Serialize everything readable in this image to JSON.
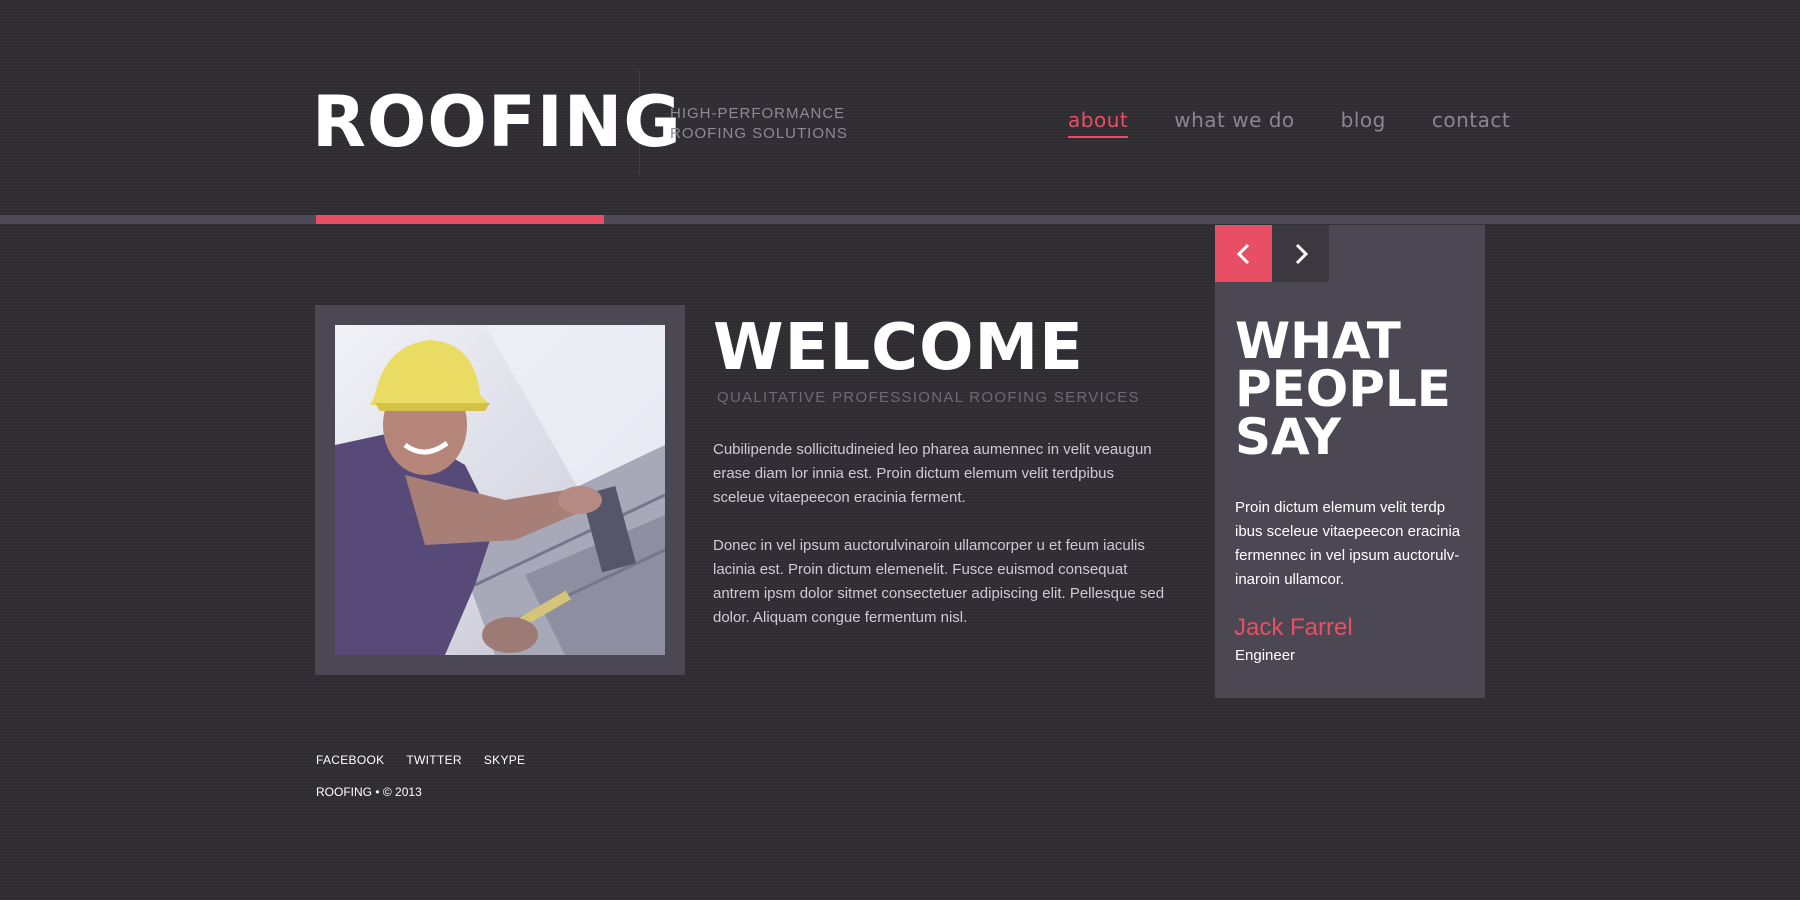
{
  "header": {
    "logo": "ROOFING",
    "tagline_line1": "HIGH-PERFORMANCE",
    "tagline_line2": "ROOFING SOLUTIONS"
  },
  "nav": {
    "items": [
      {
        "label": "about",
        "active": true
      },
      {
        "label": "what we do",
        "active": false
      },
      {
        "label": "blog",
        "active": false
      },
      {
        "label": "contact",
        "active": false
      }
    ]
  },
  "welcome": {
    "title": "WELCOME",
    "subtitle": "QUALITATIVE PROFESSIONAL ROOFING SERVICES",
    "paragraph1": "Cubilipende sollicitudineied leo pharea aumennec in velit veaugun erase diam lor innia est. Proin dictum elemum velit terdpibus sceleue vitaepeecon eracinia ferment.",
    "paragraph2": "Donec in vel ipsum auctorulvinaroin ullamcorper u et feum iaculis lacinia est. Proin dictum elemenelit. Fusce euismod consequat antrem ipsm dolor sitmet consectetuer adipiscing elit. Pellesque sed dolor. Aliquam congue fermentum nisl."
  },
  "testimonial": {
    "title_line1": "WHAT",
    "title_line2": "PEOPLE",
    "title_line3": "SAY",
    "quote": "Proin dictum elemum velit terdp ibus sceleue vitaepeecon eracinia fermennec in vel ipsum auctorulv-inaroin ullamcor.",
    "author": "Jack Farrel",
    "role": "Engineer"
  },
  "footer": {
    "links": [
      "FACEBOOK",
      "TWITTER",
      "SKYPE"
    ],
    "copyright": "ROOFING • © 2013"
  },
  "colors": {
    "background": "#302e33",
    "accent": "#e94f64",
    "panel": "#4b4753",
    "band": "#4d4956"
  },
  "icons": {
    "prev": "chevron-left-icon",
    "next": "chevron-right-icon"
  }
}
